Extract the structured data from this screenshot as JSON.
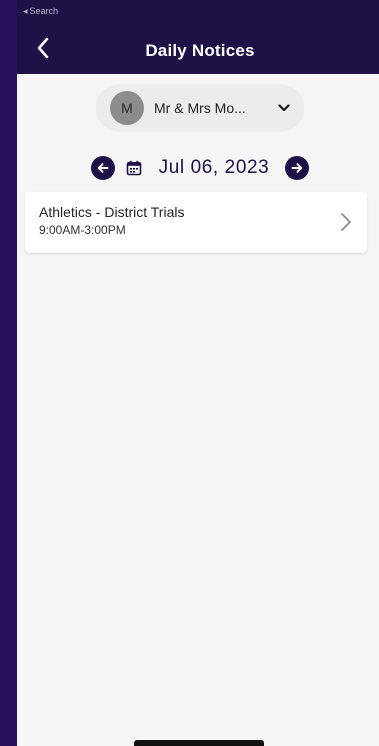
{
  "status_bar": {
    "back_arrow": "◂",
    "back_label": "Search"
  },
  "header": {
    "title": "Daily Notices",
    "back_icon": "chevron-left-icon"
  },
  "selector": {
    "avatar_initial": "M",
    "name": "Mr & Mrs Mo...",
    "dropdown_icon": "chevron-down-icon"
  },
  "date_nav": {
    "date": "Jul 06, 2023",
    "prev_icon": "arrow-left-icon",
    "next_icon": "arrow-right-icon",
    "calendar_icon": "calendar-icon"
  },
  "notices": [
    {
      "title": "Athletics - District Trials",
      "time": "9:00AM-3:00PM"
    }
  ],
  "colors": {
    "brand": "#1f1045",
    "background": "#f5f5f5",
    "outer": "#2a0f5c"
  }
}
